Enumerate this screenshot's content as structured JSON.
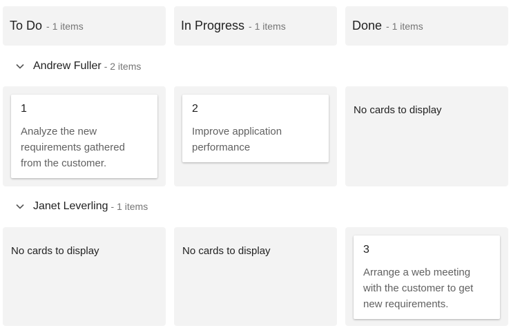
{
  "columns": [
    {
      "title": "To Do",
      "count": "- 1 items"
    },
    {
      "title": "In Progress",
      "count": "- 1 items"
    },
    {
      "title": "Done",
      "count": "- 1 items"
    }
  ],
  "swimlanes": [
    {
      "name": "Andrew Fuller",
      "count": "- 2 items",
      "cells": [
        {
          "card": {
            "id": "1",
            "text": "Analyze the new requirements gathered from the customer."
          }
        },
        {
          "card": {
            "id": "2",
            "text": "Improve application performance"
          }
        },
        {
          "empty": "No cards to display"
        }
      ]
    },
    {
      "name": "Janet Leverling",
      "count": "- 1 items",
      "cells": [
        {
          "empty": "No cards to display"
        },
        {
          "empty": "No cards to display"
        },
        {
          "card": {
            "id": "3",
            "text": "Arrange a web meeting with the customer to get new requirements."
          }
        }
      ]
    }
  ],
  "icons": {
    "collapse": "chevron-down-icon"
  }
}
